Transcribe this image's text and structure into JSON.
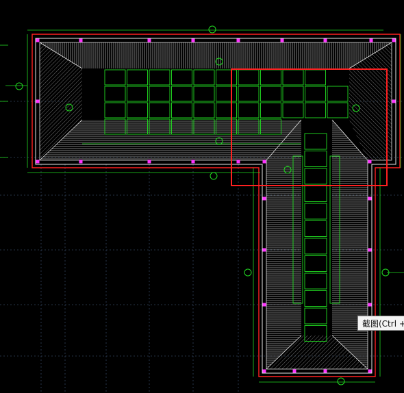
{
  "tooltip": {
    "text": "截图(Ctrl +"
  },
  "colors": {
    "background": "#000000",
    "outline_red": "#ff2020",
    "green": "#22dd22",
    "white": "#e8e8e8",
    "magenta": "#ff33ff",
    "grid": "#3a4a6a"
  },
  "icons": {
    "axis_bubble": "circle-with-number",
    "grip_marker": "magenta-square"
  }
}
